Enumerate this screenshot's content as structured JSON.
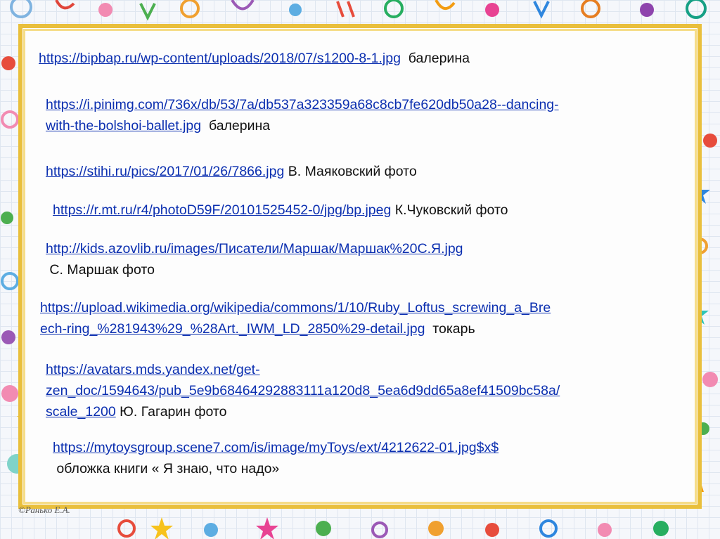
{
  "entries": [
    {
      "url": "https://bipbap.ru/wp-content/uploads/2018/07/s1200-8-1.jpg",
      "desc": "балерина"
    },
    {
      "url_line1": "https://i.pinimg.com/736x/db/53/7a/db537a323359a68c8cb7fe620db50a28--dancing-",
      "url_line2": "with-the-bolshoi-ballet.jpg",
      "desc": "балерина"
    },
    {
      "url": "https://stihi.ru/pics/2017/01/26/7866.jpg",
      "desc": "В. Маяковский фото"
    },
    {
      "url": "https://r.mt.ru/r4/photoD59F/20101525452-0/jpg/bp.jpeg",
      "desc": "К.Чуковский фото"
    },
    {
      "url": "http://kids.azovlib.ru/images/Писатели/Маршак/Маршак%20С.Я.jpg",
      "desc": "С. Маршак фото"
    },
    {
      "url_line1": "https://upload.wikimedia.org/wikipedia/commons/1/10/Ruby_Loftus_screwing_a_Bre",
      "url_line2": "ech-ring_%281943%29_%28Art._IWM_LD_2850%29-detail.jpg",
      "desc": "токарь"
    },
    {
      "url_line1": "https://avatars.mds.yandex.net/get-",
      "url_line2": "zen_doc/1594643/pub_5e9b68464292883111a120d8_5ea6d9dd65a8ef41509bc58a/",
      "url_line3": "scale_1200",
      "desc": "Ю.  Гагарин фото"
    },
    {
      "url": "https://mytoysgroup.scene7.com/is/image/myToys/ext/4212622-01.jpg$x$",
      "desc": "обложка книги « Я знаю, что надо»"
    }
  ],
  "copyright": "©Ранько Е.А."
}
